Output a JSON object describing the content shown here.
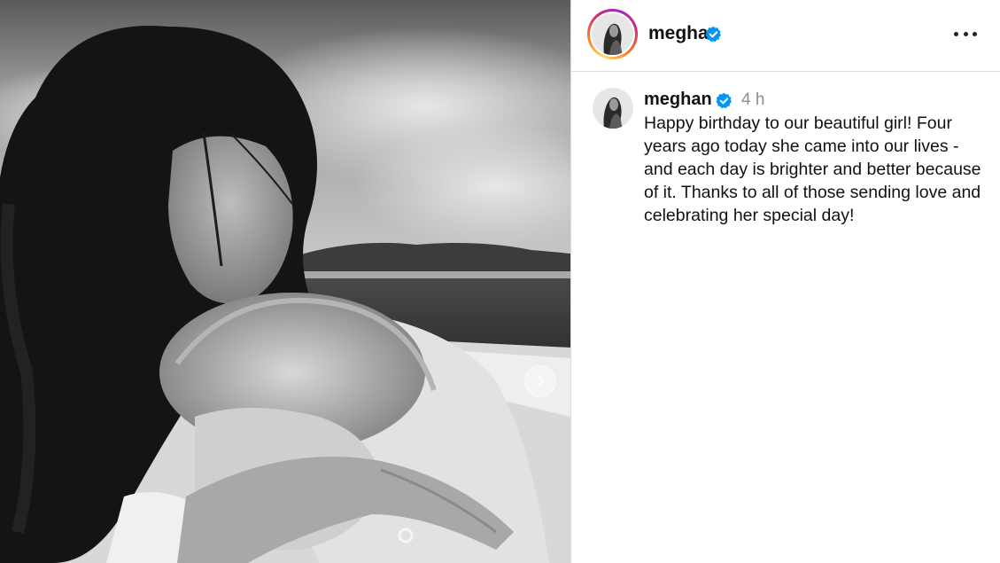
{
  "post": {
    "username": "meghan",
    "verified": true,
    "more_icon": "more-horizontal-icon",
    "media": {
      "description_icon": "photo",
      "carousel_next_icon": "chevron-right-icon"
    },
    "caption": {
      "username": "meghan",
      "timestamp": "4 h",
      "text": "Happy birthday to our beautiful girl! Four years ago today she came into our lives - and each day is brighter and better because of it. Thanks to all of those sending love and celebrating her special day!"
    }
  },
  "colors": {
    "verified_badge": "#0095f6",
    "divider": "#dbdbdb",
    "timestamp": "#8e8e8e"
  }
}
